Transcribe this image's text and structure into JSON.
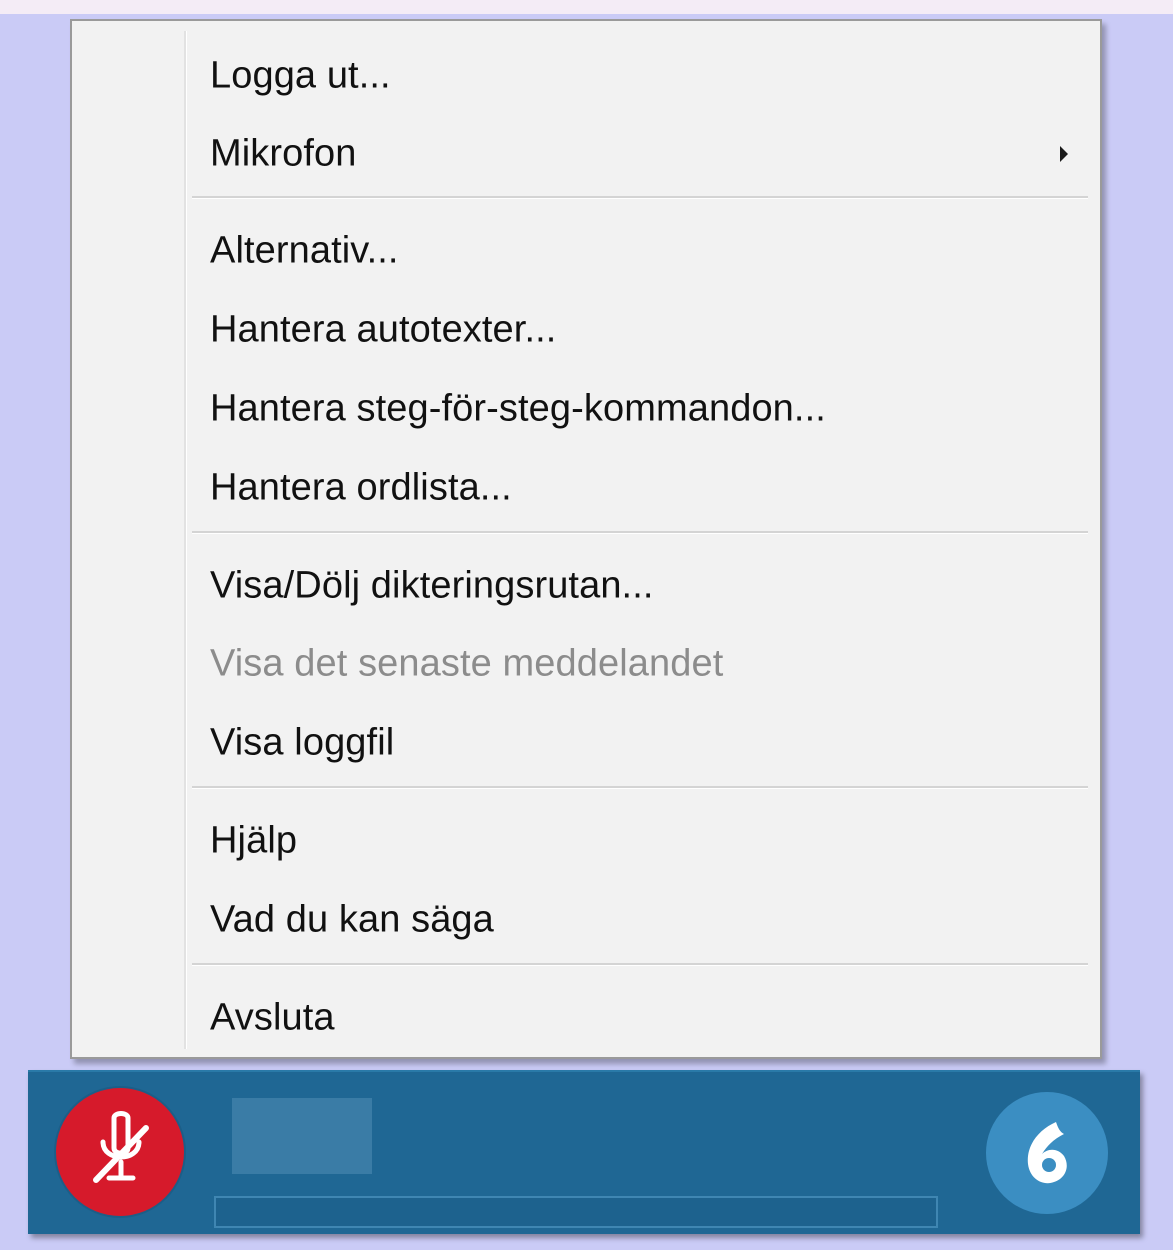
{
  "context_menu": {
    "items": [
      {
        "label": "Logga ut...",
        "enabled": true,
        "has_submenu": false
      },
      {
        "label": "Mikrofon",
        "enabled": true,
        "has_submenu": true
      },
      {
        "label": "Alternativ...",
        "enabled": true,
        "has_submenu": false
      },
      {
        "label": "Hantera autotexter...",
        "enabled": true,
        "has_submenu": false
      },
      {
        "label": "Hantera steg-för-steg-kommandon...",
        "enabled": true,
        "has_submenu": false
      },
      {
        "label": "Hantera ordlista...",
        "enabled": true,
        "has_submenu": false
      },
      {
        "label": "Visa/Dölj dikteringsrutan...",
        "enabled": true,
        "has_submenu": false
      },
      {
        "label": "Visa det senaste meddelandet",
        "enabled": false,
        "has_submenu": false
      },
      {
        "label": "Visa loggfil",
        "enabled": true,
        "has_submenu": false
      },
      {
        "label": "Hjälp",
        "enabled": true,
        "has_submenu": false
      },
      {
        "label": "Vad du kan säga",
        "enabled": true,
        "has_submenu": false
      },
      {
        "label": "Avsluta",
        "enabled": true,
        "has_submenu": false
      }
    ]
  },
  "dictation_bar": {
    "microphone_state": "off",
    "microphone_icon": "microphone-off-icon",
    "logo_icon": "dragon-logo-icon",
    "audio_level": 0
  },
  "colors": {
    "background": "#cacbf6",
    "menu_background": "#f2f2f2",
    "bar_background": "#1f6794",
    "mic_off_red": "#d61a2b",
    "logo_blue": "#3b8ec2",
    "disabled_text": "#8c8c8c"
  }
}
